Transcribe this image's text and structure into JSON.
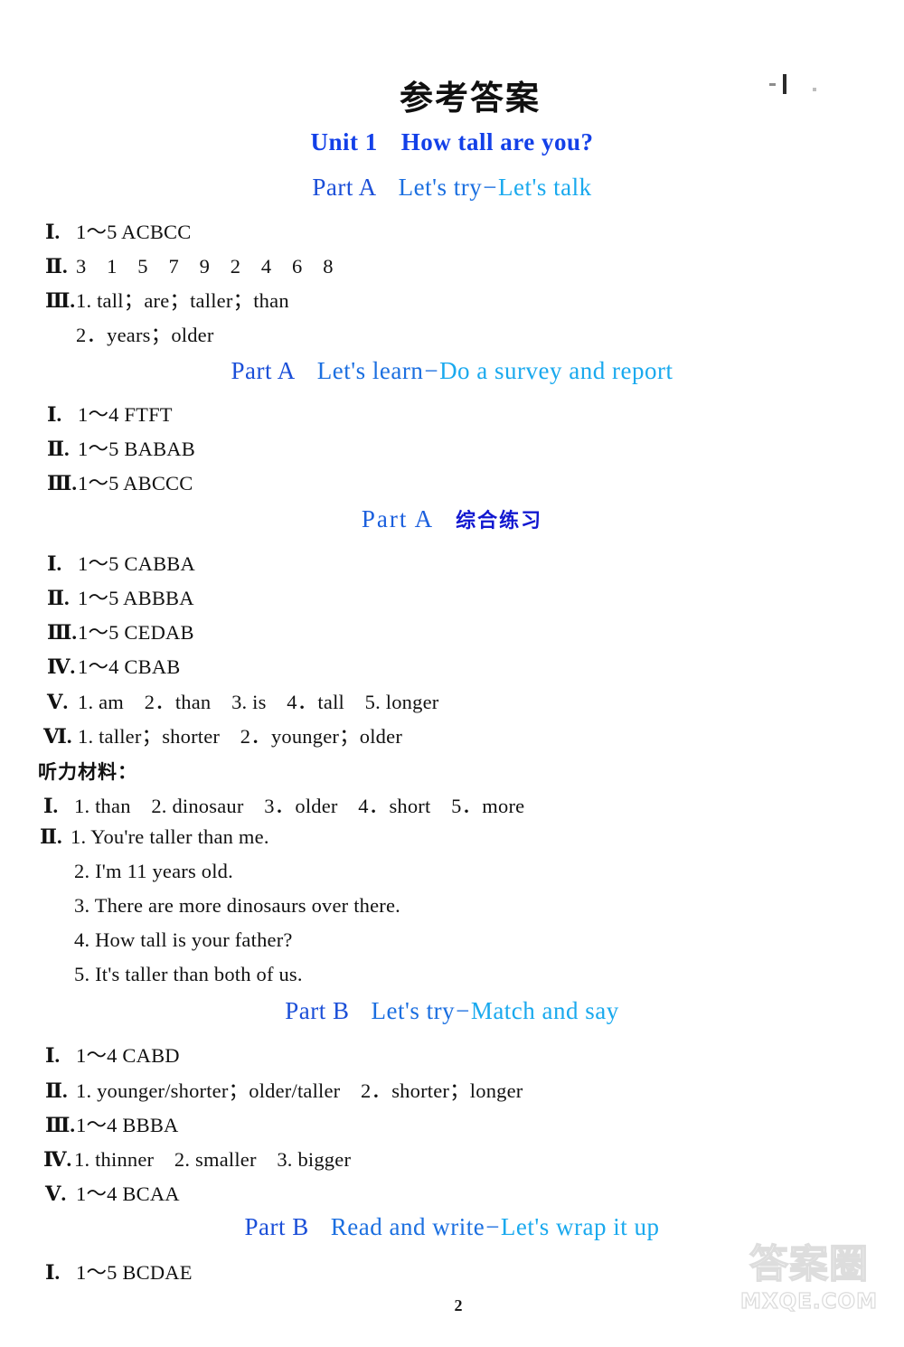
{
  "document": {
    "title": "参考答案",
    "page_number": "2"
  },
  "unit": {
    "number_label": "Unit 1",
    "name": "How tall are you?"
  },
  "sections": [
    {
      "heading_part": "Part A",
      "heading_sub_left": "Let's try",
      "heading_dash": "−",
      "heading_sub_right": "Let's talk",
      "lines": [
        {
          "num": "Ⅰ.",
          "text": "1～5 ACBCC"
        },
        {
          "num": "Ⅱ.",
          "text": "3　1　5　7　9　2　4　6　8"
        },
        {
          "num": "Ⅲ.",
          "text": "1. tall；are；taller；than"
        },
        {
          "num": "",
          "text": "2．years；older"
        }
      ]
    },
    {
      "heading_part": "Part A",
      "heading_sub_left": "Let's learn",
      "heading_dash": "−",
      "heading_sub_right": "Do a survey and report",
      "lines": [
        {
          "num": "Ⅰ.",
          "text": "1～4 FTFT"
        },
        {
          "num": "Ⅱ.",
          "text": "1～5 BABAB"
        },
        {
          "num": "Ⅲ.",
          "text": "1～5 ABCCC"
        }
      ]
    },
    {
      "heading_part": "Part A",
      "heading_cn": "综合练习",
      "lines": [
        {
          "num": "Ⅰ.",
          "text": "1～5 CABBA"
        },
        {
          "num": "Ⅱ.",
          "text": "1～5 ABBBA"
        },
        {
          "num": "Ⅲ.",
          "text": "1～5 CEDAB"
        },
        {
          "num": "Ⅳ.",
          "text": "1～4 CBAB"
        },
        {
          "num": "Ⅴ.",
          "text": "1. am　2．than　3. is　4．tall　5. longer"
        },
        {
          "num": "Ⅵ.",
          "text": "1. taller；shorter　2．younger；older"
        }
      ]
    },
    {
      "label_cn": "听力材料：",
      "lines": [
        {
          "num": "Ⅰ.",
          "text": "1. than　2. dinosaur　3．older　4．short　5．more"
        },
        {
          "num": "Ⅱ.",
          "text": "1. You're taller than me."
        },
        {
          "num": "",
          "text": "2. I'm 11 years old."
        },
        {
          "num": "",
          "text": "3. There are more dinosaurs over there."
        },
        {
          "num": "",
          "text": "4. How tall is your father?"
        },
        {
          "num": "",
          "text": "5. It's taller than both of us."
        }
      ]
    },
    {
      "heading_part": "Part B",
      "heading_sub_left": "Let's try",
      "heading_dash": "−",
      "heading_sub_right": "Match and say",
      "lines": [
        {
          "num": "Ⅰ.",
          "text": "1～4 CABD"
        },
        {
          "num": "Ⅱ.",
          "text": "1. younger/shorter；older/taller　2．shorter；longer"
        },
        {
          "num": "Ⅲ.",
          "text": "1～4 BBBA"
        },
        {
          "num": "Ⅳ.",
          "text": "1. thinner　2. smaller　3. bigger"
        },
        {
          "num": "Ⅴ.",
          "text": "1～4 BCAA"
        }
      ]
    },
    {
      "heading_part": "Part B",
      "heading_sub_left": "Read and write",
      "heading_dash": "−",
      "heading_sub_right": "Let's wrap it up",
      "lines": [
        {
          "num": "Ⅰ.",
          "text": "1～5 BCDAE"
        }
      ]
    }
  ],
  "watermark": {
    "cn": "答案圈",
    "en": "MXQE.COM"
  },
  "colors": {
    "unit_title": "#1340e8",
    "part_label": "#1b4fd8",
    "part_sub": "#19a9ee",
    "cn_heading": "#1218d0",
    "body_text": "#111111"
  }
}
